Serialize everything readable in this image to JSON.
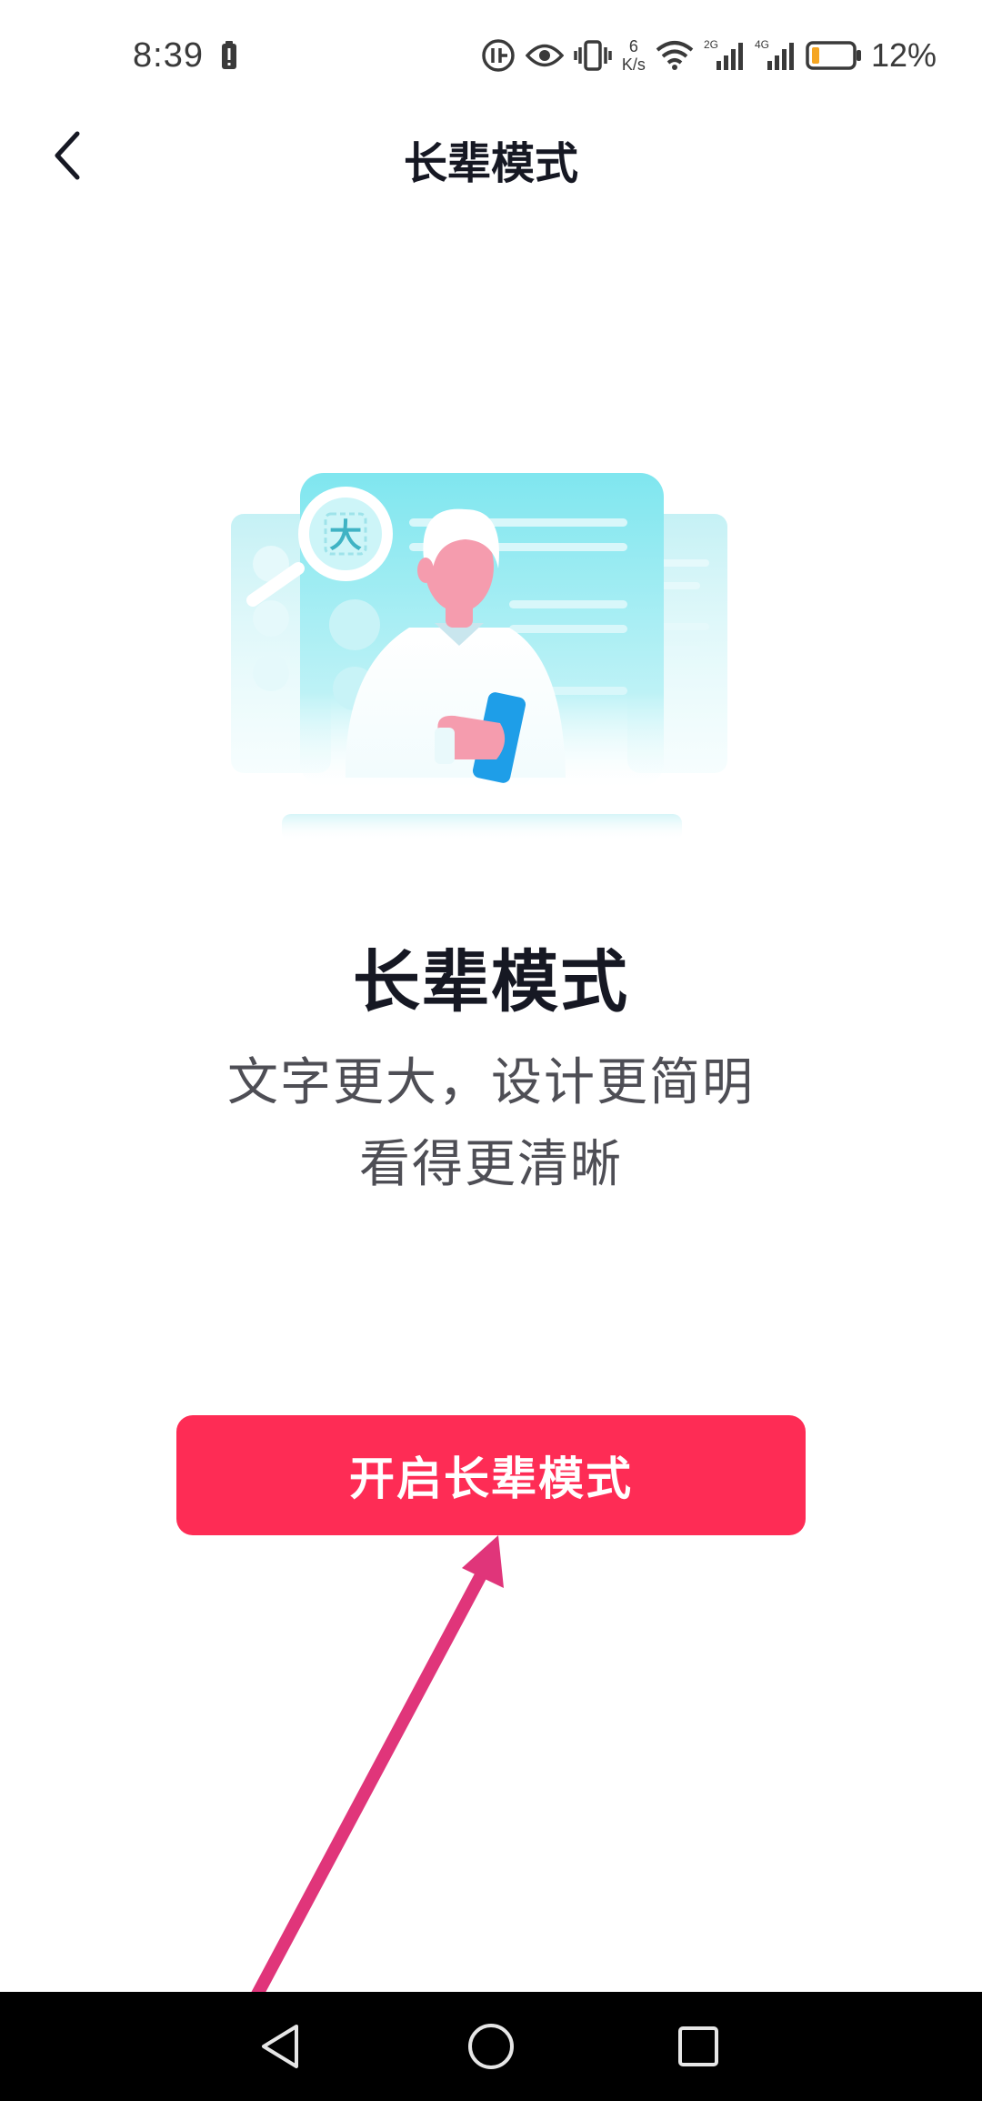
{
  "status_bar": {
    "time": "8:39",
    "net_speed_value": "6",
    "net_speed_unit": "K/s",
    "signal1_label": "2G",
    "signal2_label": "4G",
    "battery_level": 0.12,
    "battery_text": "12%"
  },
  "header": {
    "title": "长辈模式",
    "back_icon": "chevron-left-icon"
  },
  "illustration": {
    "badge_text": "大"
  },
  "content": {
    "heading": "长辈模式",
    "desc_line1": "文字更大，设计更简明",
    "desc_line2": "看得更清晰"
  },
  "actions": {
    "enable_label": "开启长辈模式"
  },
  "colors": {
    "accent": "#fe2c55",
    "annotation": "#e0357a",
    "battery_low": "#f5a623"
  },
  "nav_bar": {
    "back_icon": "triangle-back-icon",
    "home_icon": "circle-home-icon",
    "recents_icon": "square-recents-icon"
  }
}
